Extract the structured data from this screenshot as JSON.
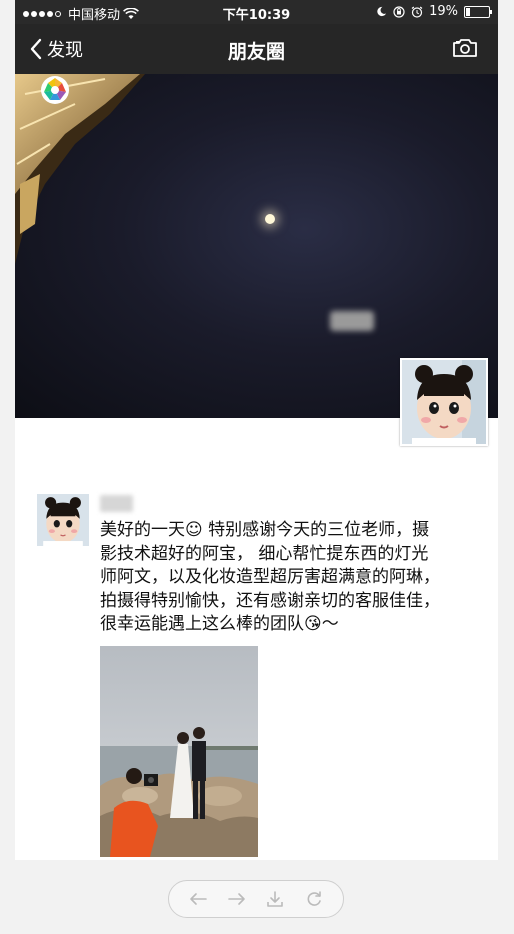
{
  "status_bar": {
    "carrier": "中国移动",
    "time": "下午10:39",
    "battery_percent": "19%",
    "battery_level": 0.19,
    "icons": [
      "signal-dots-icon",
      "wifi-icon",
      "moon-icon",
      "rotation-lock-icon",
      "alarm-icon",
      "battery-icon"
    ]
  },
  "nav": {
    "back_label": "发现",
    "title": "朋友圈",
    "camera_icon": "camera-icon"
  },
  "post": {
    "text": "美好的一天☺ 特别感谢今天的三位老师，摄\n影技术超好的阿宝， 细心帮忙提东西的灯光\n师阿文，以及化妆造型超厉害超满意的阿琳，\n拍摄得特别愉快，还有感谢亲切的客服佳佳，\n很幸运能遇上这么棒的团队😘～"
  },
  "toolbar": {
    "icons": [
      "back-arrow-icon",
      "forward-arrow-icon",
      "download-icon",
      "refresh-icon"
    ]
  },
  "colors": {
    "nav_bg": "#262626",
    "status_bg": "#2a2a2a",
    "page_bg": "#f2f2f2"
  }
}
